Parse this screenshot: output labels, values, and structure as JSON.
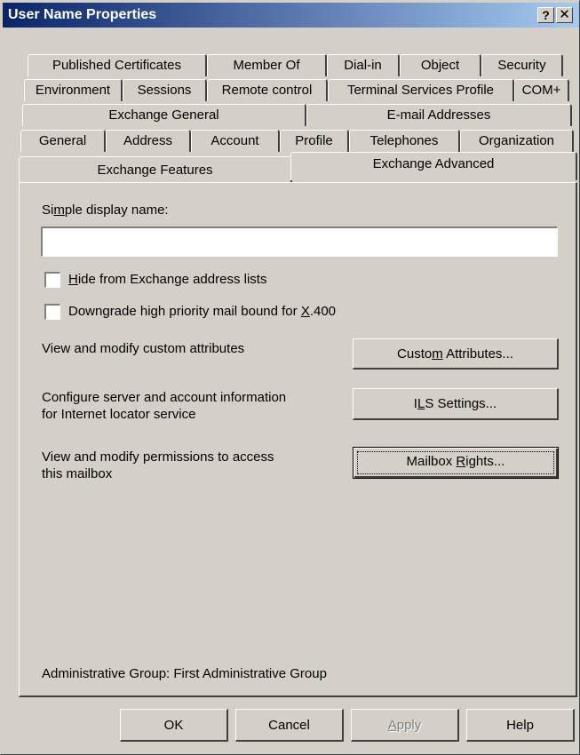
{
  "window": {
    "title": "User Name Properties",
    "help_glyph": "?",
    "close_glyph": "✕"
  },
  "tabs": {
    "row1": [
      "Published Certificates",
      "Member Of",
      "Dial-in",
      "Object",
      "Security"
    ],
    "row2": [
      "Environment",
      "Sessions",
      "Remote control",
      "Terminal Services Profile",
      "COM+"
    ],
    "row3": [
      "Exchange General",
      "E-mail Addresses"
    ],
    "row4": [
      "General",
      "Address",
      "Account",
      "Profile",
      "Telephones",
      "Organization"
    ],
    "row5": [
      "Exchange Features",
      "Exchange Advanced"
    ],
    "active": "Exchange Advanced"
  },
  "form": {
    "display_name_label_pre": "Si",
    "display_name_label_key": "m",
    "display_name_label_post": "ple display name:",
    "display_name_value": "",
    "hide_label_key": "H",
    "hide_label_post": "ide from Exchange address lists",
    "hide_checked": false,
    "downgrade_label_pre": "Downgrade high priority mail bound for ",
    "downgrade_label_key": "X",
    "downgrade_label_post": ".400",
    "downgrade_checked": false,
    "custom_attr_text": "View and modify custom attributes",
    "custom_attr_button_pre": "Custo",
    "custom_attr_button_key": "m",
    "custom_attr_button_post": " Attributes...",
    "ils_text_line1": "Configure server and account information",
    "ils_text_line2": "for Internet locator service",
    "ils_button_pre": "I",
    "ils_button_key": "L",
    "ils_button_post": "S Settings...",
    "mailbox_text_line1": "View and modify permissions to access",
    "mailbox_text_line2": "this mailbox",
    "mailbox_button_pre": "Mailbox ",
    "mailbox_button_key": "R",
    "mailbox_button_post": "ights...",
    "admin_group": "Administrative Group: First Administrative Group"
  },
  "footer": {
    "ok": "OK",
    "cancel": "Cancel",
    "apply_key": "A",
    "apply_post": "pply",
    "help": "Help"
  }
}
